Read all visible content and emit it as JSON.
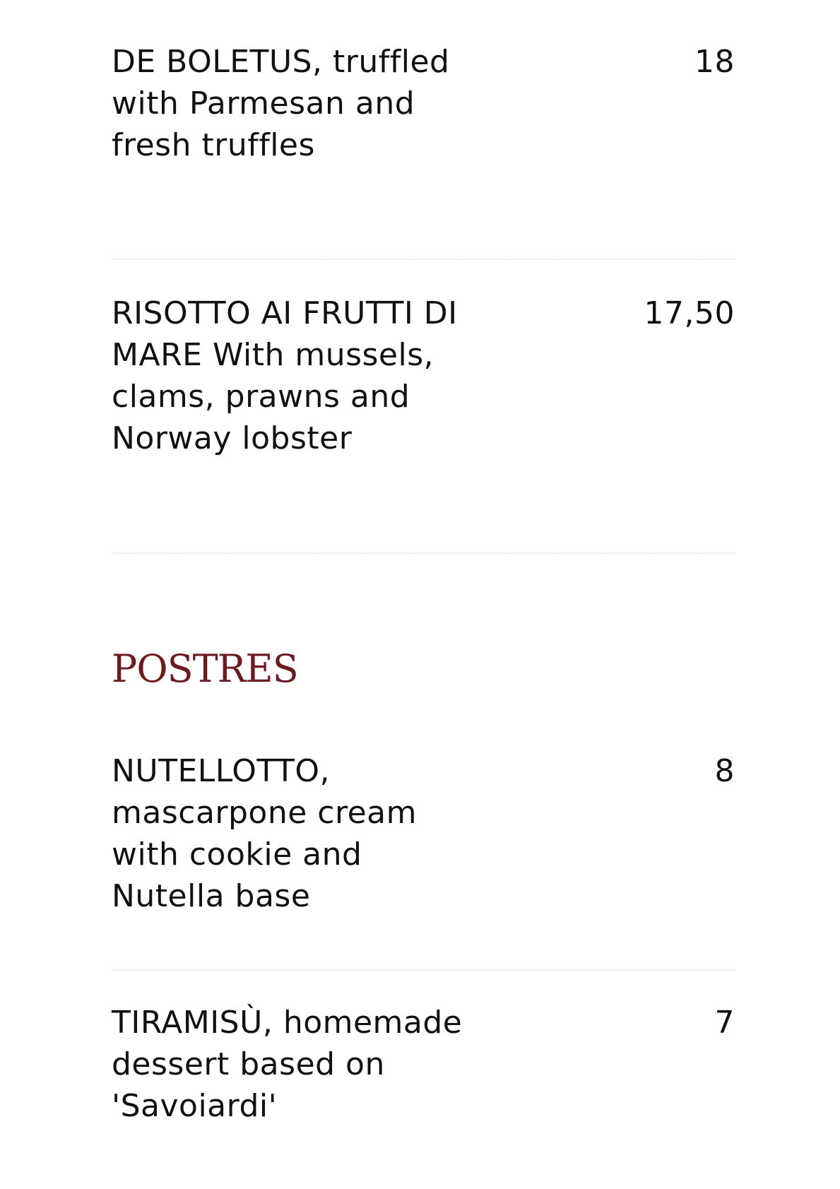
{
  "items_top": [
    {
      "name": "DE BOLETUS,",
      "description": "truffled with Parmesan and fresh truffles",
      "price": "18"
    },
    {
      "name": "RISOTTO AI FRUTTI DI MARE",
      "description": "With mussels, clams, prawns and Norway lobster",
      "price": "17,50"
    }
  ],
  "section": {
    "title": "POSTRES",
    "color": "#6b1a1f"
  },
  "items_bottom": [
    {
      "name": "NUTELLOTTO,",
      "description": "mascarpone cream with cookie and Nutella base",
      "price": "8"
    },
    {
      "name": "TIRAMISÙ,",
      "description": "homemade dessert based on 'Savoiardi'",
      "price": "7"
    }
  ]
}
